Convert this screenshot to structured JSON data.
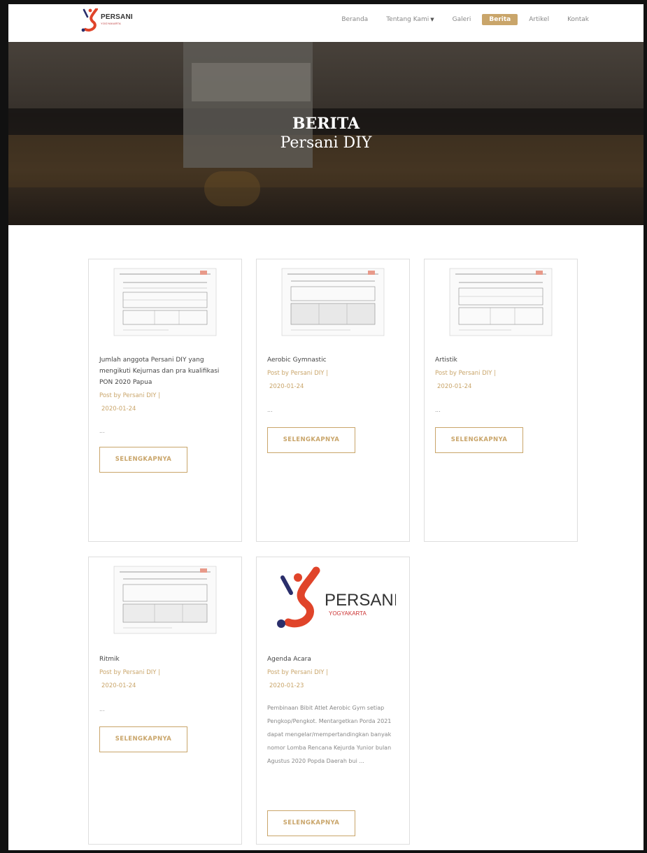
{
  "brand": {
    "name": "PERSANI",
    "sub": "YOGYAKARTA",
    "colors": {
      "red": "#e0442a",
      "navy": "#2a2e6b"
    }
  },
  "nav": {
    "items": [
      {
        "label": "Beranda"
      },
      {
        "label": "Tentang Kami"
      },
      {
        "label": "Galeri"
      },
      {
        "label": "Berita",
        "active": true
      },
      {
        "label": "Artikel"
      },
      {
        "label": "Kontak"
      }
    ],
    "dropdown_caret": "▼",
    "accent": "#c9a56a"
  },
  "hero": {
    "title_line1": "BERITA",
    "title_line2": "Persani DIY"
  },
  "posts": [
    {
      "title": "Jumlah anggota Persani DIY yang mengikuti Kejurnas dan pra kualifikasi PON 2020 Papua",
      "author": "Post by Persani DIY  |",
      "date": "2020-01-24",
      "excerpt": "...",
      "button": "SELENGKAPNYA",
      "thumbnail": "document-scan"
    },
    {
      "title": "Aerobic Gymnastic",
      "author": "Post by Persani DIY  |",
      "date": "2020-01-24",
      "excerpt": "...",
      "button": "SELENGKAPNYA",
      "thumbnail": "document-scan"
    },
    {
      "title": "Artistik",
      "author": "Post by Persani DIY  |",
      "date": "2020-01-24",
      "excerpt": "...",
      "button": "SELENGKAPNYA",
      "thumbnail": "document-scan"
    },
    {
      "title": "Ritmik",
      "author": "Post by Persani DIY  |",
      "date": "2020-01-24",
      "excerpt": "...",
      "button": "SELENGKAPNYA",
      "thumbnail": "document-scan"
    },
    {
      "title": "Agenda Acara",
      "author": "Post by Persani DIY  |",
      "date": "2020-01-23",
      "excerpt": "Pembinaan Bibit Atlet Aerobic Gym setiap Pengkop/Pengkot. Mentargetkan Porda 2021 dapat mengelar/mempertandingkan banyak nomor Lomba Rencana Kejurda Yunior bulan Agustus 2020 Popda Daerah bui ...",
      "button": "SELENGKAPNYA",
      "thumbnail": "persani-logo",
      "logo_name": "PERSANI",
      "logo_sub": "YOGYAKARTA"
    }
  ]
}
